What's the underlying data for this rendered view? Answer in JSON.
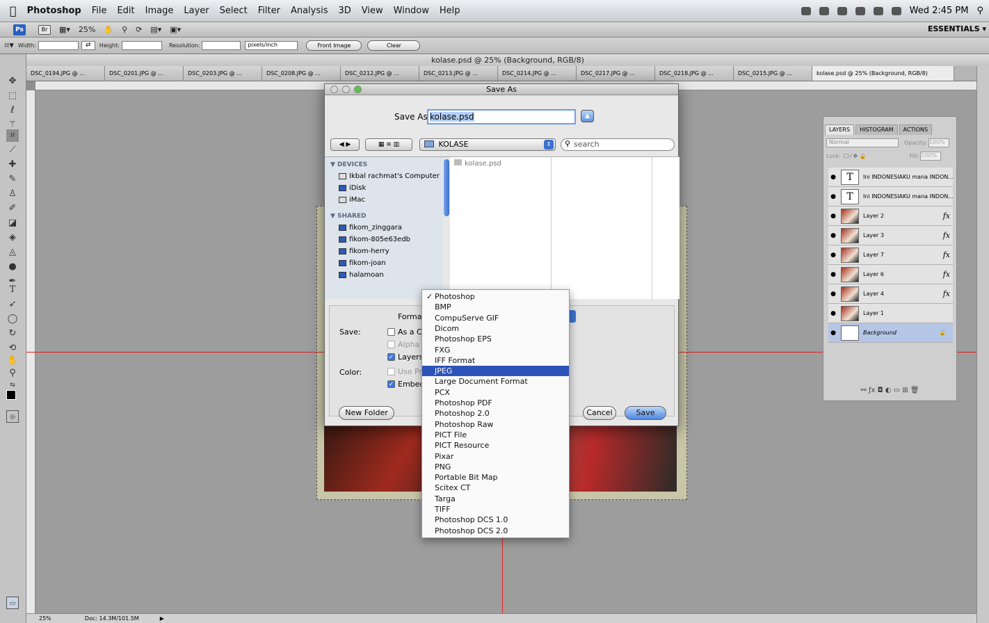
{
  "menubar": {
    "app": "Photoshop",
    "items": [
      "File",
      "Edit",
      "Image",
      "Layer",
      "Select",
      "Filter",
      "Analysis",
      "3D",
      "View",
      "Window",
      "Help"
    ],
    "clock": "Wed 2:45 PM"
  },
  "appbar": {
    "ps": "Ps",
    "br": "Br",
    "zoom": "25%",
    "workspace": "ESSENTIALS ▾"
  },
  "options": {
    "width_label": "Width:",
    "height_label": "Height:",
    "resolution_label": "Resolution:",
    "unit": "pixels/inch",
    "front_image": "Front Image",
    "clear": "Clear"
  },
  "document": {
    "title": "kolase.psd @ 25% (Background, RGB/8)",
    "tabs": [
      "DSC_0194.JPG @ ...",
      "DSC_0201.JPG @ ...",
      "DSC_0203.JPG @ ...",
      "DSC_0208.JPG @ ...",
      "DSC_0212.JPG @ ...",
      "DSC_0213.JPG @ ...",
      "DSC_0214.JPG @ ...",
      "DSC_0217.JPG @ ...",
      "DSC_0218.JPG @ ...",
      "DSC_0215.JPG @ ...",
      "kolase.psd @ 25% (Background, RGB/8)"
    ],
    "status_zoom": "25%",
    "status_doc": "Doc: 14.3M/101.5M"
  },
  "layers_panel": {
    "tabs": [
      "LAYERS",
      "HISTOGRAM",
      "ACTIONS"
    ],
    "blend": "Normal",
    "opacity_label": "Opacity:",
    "opacity": "100%",
    "lock_label": "Lock:",
    "fill_label": "Fill:",
    "fill": "100%",
    "layers": [
      {
        "name": "Ini INDONESIAKU mana INDON...",
        "type": "text",
        "fx": ""
      },
      {
        "name": "Ini INDONESIAKU mana INDON...",
        "type": "text",
        "fx": ""
      },
      {
        "name": "Layer 2",
        "type": "image",
        "fx": "fx"
      },
      {
        "name": "Layer 3",
        "type": "image",
        "fx": "fx"
      },
      {
        "name": "Layer 7",
        "type": "image",
        "fx": "fx"
      },
      {
        "name": "Layer 6",
        "type": "image",
        "fx": "fx"
      },
      {
        "name": "Layer 4",
        "type": "image",
        "fx": "fx"
      },
      {
        "name": "Layer 1",
        "type": "image",
        "fx": ""
      },
      {
        "name": "Background",
        "type": "background",
        "fx": ""
      }
    ]
  },
  "dialog": {
    "title": "Save As",
    "save_as_label": "Save As:",
    "filename": "kolase.psd",
    "folder": "KOLASE",
    "search_placeholder": "search",
    "devices_header": "▼ DEVICES",
    "devices": [
      "Ikbal rachmat's Computer",
      "iDisk",
      "iMac"
    ],
    "shared_header": "▼ SHARED",
    "shared": [
      "fikom_zinggara",
      "fikom-805e63edb",
      "fikom-herry",
      "fikom-joan",
      "halamoan"
    ],
    "files": [
      "kolase.psd"
    ],
    "format_label": "Format:",
    "save_label": "Save:",
    "color_label": "Color:",
    "as_copy": "As a C",
    "alpha": "Alpha",
    "layers": "Layers",
    "use_proof": "Use Pr",
    "embed": "Embed",
    "new_folder": "New Folder",
    "cancel": "Cancel",
    "save": "Save"
  },
  "format_menu": {
    "items": [
      "Photoshop",
      "BMP",
      "CompuServe GIF",
      "Dicom",
      "Photoshop EPS",
      "FXG",
      "IFF Format",
      "JPEG",
      "Large Document Format",
      "PCX",
      "Photoshop PDF",
      "Photoshop 2.0",
      "Photoshop Raw",
      "PICT File",
      "PICT Resource",
      "Pixar",
      "PNG",
      "Portable Bit Map",
      "Scitex CT",
      "Targa",
      "TIFF",
      "Photoshop DCS 1.0",
      "Photoshop DCS 2.0"
    ],
    "checked": "Photoshop",
    "highlighted": "JPEG"
  }
}
